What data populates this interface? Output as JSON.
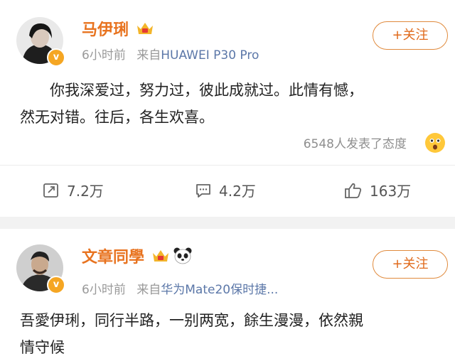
{
  "posts": [
    {
      "username": "马伊琍",
      "time": "6小时前",
      "from_prefix": "来自",
      "source": "HUAWEI P30 Pro",
      "follow_label": "+关注",
      "content_line1": "你我深爱过，努力过，彼此成就过。此情有憾，",
      "content_line2": "然无对错。往后，各生欢喜。",
      "reactions_text": "6548人发表了态度",
      "share_count": "7.2万",
      "comment_count": "4.2万",
      "like_count": "163万",
      "verified_label": "v"
    },
    {
      "username": "文章同學",
      "time": "6小时前",
      "from_prefix": "来自",
      "source": "华为Mate20保时捷...",
      "follow_label": "+关注",
      "content_line1": "吾愛伊琍，同行半路，一别两宽，餘生漫漫，依然親",
      "content_line2": "情守候",
      "verified_label": "v"
    }
  ],
  "colors": {
    "username": "#e8731f",
    "source": "#5b77a8",
    "follow_border": "#e08a3c",
    "verified": "#f5a623",
    "divider": "#f2f2f2"
  },
  "icons": [
    "share-icon",
    "comment-icon",
    "like-icon",
    "surprised-emoji-icon",
    "vip-crown-icon",
    "panda-icon"
  ]
}
